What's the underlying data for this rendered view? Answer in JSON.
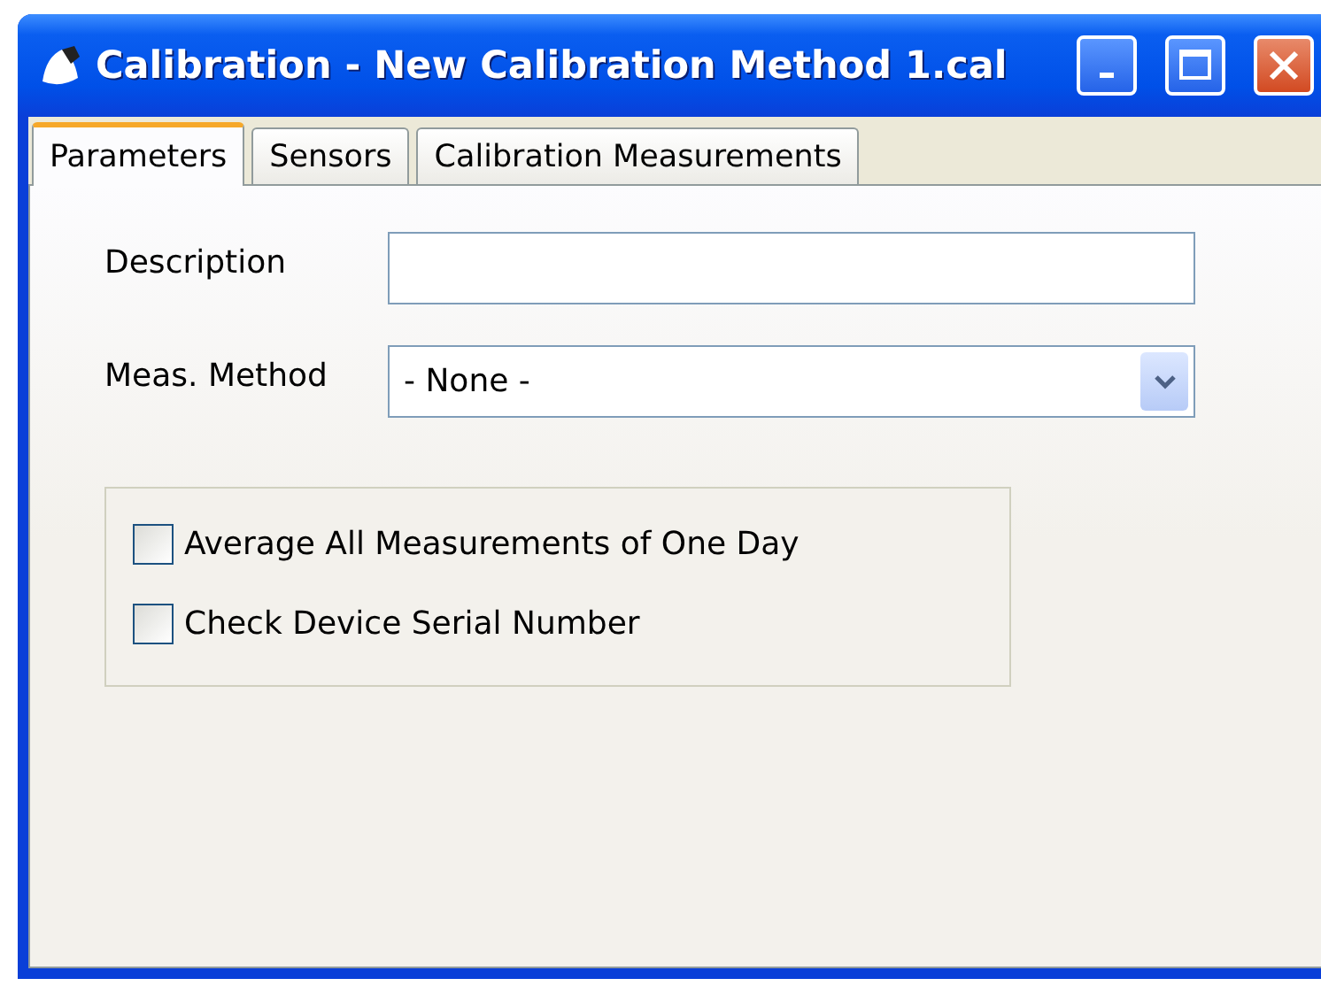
{
  "window": {
    "title": "Calibration - New Calibration Method 1.cal"
  },
  "tabs": [
    {
      "label": "Parameters",
      "selected": true
    },
    {
      "label": "Sensors",
      "selected": false
    },
    {
      "label": "Calibration Measurements",
      "selected": false
    }
  ],
  "fields": {
    "description": {
      "label": "Description"
    },
    "meas_method": {
      "label": "Meas. Method",
      "value": "- None -"
    }
  },
  "options": [
    {
      "label": "Average All Measurements of One Day",
      "checked": false
    },
    {
      "label": "Check Device Serial Number",
      "checked": false
    }
  ]
}
